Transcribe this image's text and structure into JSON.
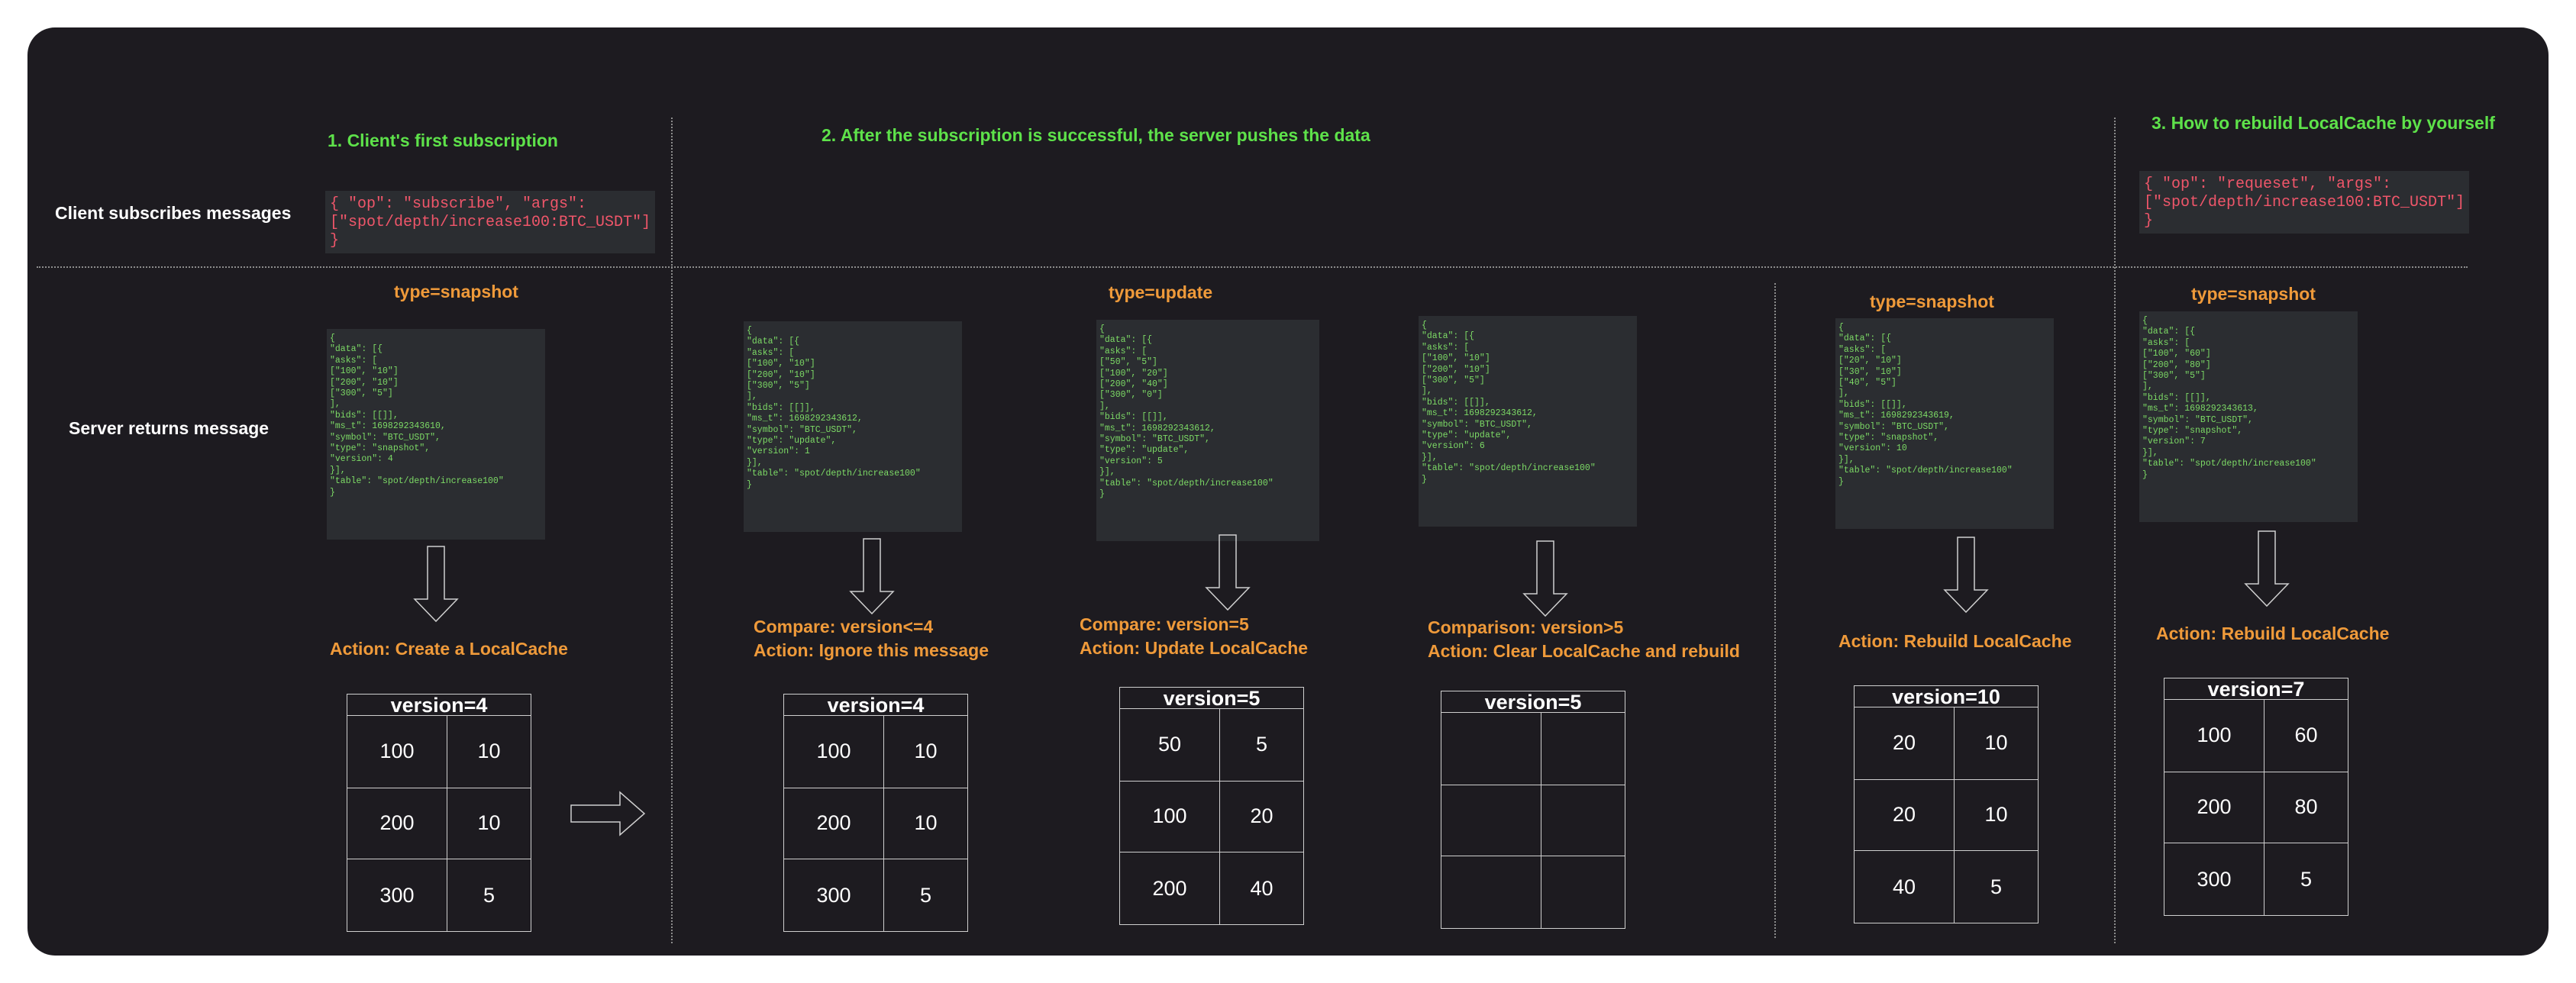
{
  "steps": {
    "step1": "1. Client's first subscription",
    "step2": "2. After the subscription is successful, the server pushes the data",
    "step3": "3. How to rebuild LocalCache by yourself"
  },
  "rows": {
    "client_label": "Client subscribes messages",
    "server_label": "Server returns message"
  },
  "requests": {
    "subscribe": "{ \"op\": \"subscribe\", \"args\":\n[\"spot/depth/increase100:BTC_USDT\"]\n}",
    "requeset": "{ \"op\": \"requeset\", \"args\":\n[\"spot/depth/increase100:BTC_USDT\"]\n}"
  },
  "columns": [
    {
      "type_label": "type=snapshot",
      "message": "{\n\"data\": [{\n\"asks\": [\n[\"100\", \"10\"]\n[\"200\", \"10\"]\n[\"300\", \"5\"]\n],\n\"bids\": [[]],\n\"ms_t\": 1698292343610,\n\"symbol\": \"BTC_USDT\",\n\"type\": \"snapshot\",\n\"version\": 4\n}],\n\"table\": \"spot/depth/increase100\"\n}",
      "action": "Action: Create a LocalCache",
      "cache": {
        "header": "version=4",
        "rows": [
          [
            "100",
            "10"
          ],
          [
            "200",
            "10"
          ],
          [
            "300",
            "5"
          ]
        ]
      }
    },
    {
      "type_label": "",
      "message": "{\n\"data\": [{\n\"asks\": [\n[\"100\", \"10\"]\n[\"200\", \"10\"]\n[\"300\", \"5\"]\n],\n\"bids\": [[]],\n\"ms_t\": 1698292343612,\n\"symbol\": \"BTC_USDT\",\n\"type\": \"update\",\n\"version\": 1\n}],\n\"table\": \"spot/depth/increase100\"\n}",
      "action": "Compare: version<=4\nAction: Ignore this message",
      "cache": {
        "header": "version=4",
        "rows": [
          [
            "100",
            "10"
          ],
          [
            "200",
            "10"
          ],
          [
            "300",
            "5"
          ]
        ]
      }
    },
    {
      "type_label": "type=update",
      "message": "{\n\"data\": [{\n\"asks\": [\n[\"50\", \"5\"]\n[\"100\", \"20\"]\n[\"200\", \"40\"]\n[\"300\", \"0\"]\n],\n\"bids\": [[]],\n\"ms_t\": 1698292343612,\n\"symbol\": \"BTC_USDT\",\n\"type\": \"update\",\n\"version\": 5\n}],\n\"table\": \"spot/depth/increase100\"\n}",
      "action": "Compare: version=5\nAction: Update LocalCache",
      "cache": {
        "header": "version=5",
        "rows": [
          [
            "50",
            "5"
          ],
          [
            "100",
            "20"
          ],
          [
            "200",
            "40"
          ]
        ]
      }
    },
    {
      "type_label": "",
      "message": "{\n\"data\": [{\n\"asks\": [\n[\"100\", \"10\"]\n[\"200\", \"10\"]\n[\"300\", \"5\"]\n],\n\"bids\": [[]],\n\"ms_t\": 1698292343612,\n\"symbol\": \"BTC_USDT\",\n\"type\": \"update\",\n\"version\": 6\n}],\n\"table\": \"spot/depth/increase100\"\n}",
      "action": "Comparison: version>5\nAction: Clear LocalCache and rebuild",
      "cache": {
        "header": "version=5",
        "rows": [
          [
            "",
            ""
          ],
          [
            "",
            ""
          ],
          [
            "",
            ""
          ]
        ]
      }
    },
    {
      "type_label": "type=snapshot",
      "message": "{\n\"data\": [{\n\"asks\": [\n[\"20\", \"10\"]\n[\"30\", \"10\"]\n[\"40\", \"5\"]\n],\n\"bids\": [[]],\n\"ms_t\": 1698292343619,\n\"symbol\": \"BTC_USDT\",\n\"type\": \"snapshot\",\n\"version\": 10\n}],\n\"table\": \"spot/depth/increase100\"\n}",
      "action": "Action: Rebuild LocalCache",
      "cache": {
        "header": "version=10",
        "rows": [
          [
            "20",
            "10"
          ],
          [
            "20",
            "10"
          ],
          [
            "40",
            "5"
          ]
        ]
      }
    },
    {
      "type_label": "type=snapshot",
      "message": "{\n\"data\": [{\n\"asks\": [\n[\"100\", \"60\"]\n[\"200\", \"80\"]\n[\"300\", \"5\"]\n],\n\"bids\": [[]],\n\"ms_t\": 1698292343613,\n\"symbol\": \"BTC_USDT\",\n\"type\": \"snapshot\",\n\"version\": 7\n}],\n\"table\": \"spot/depth/increase100\"\n}",
      "action": "Action: Rebuild LocalCache",
      "cache": {
        "header": "version=7",
        "rows": [
          [
            "100",
            "60"
          ],
          [
            "200",
            "80"
          ],
          [
            "300",
            "5"
          ]
        ]
      }
    }
  ],
  "colors": {
    "background": "#1d1b20",
    "step_title": "#5ee24a",
    "action_text": "#ef9a3a",
    "request_code": "#f0566a",
    "message_code": "#7ddb66"
  }
}
